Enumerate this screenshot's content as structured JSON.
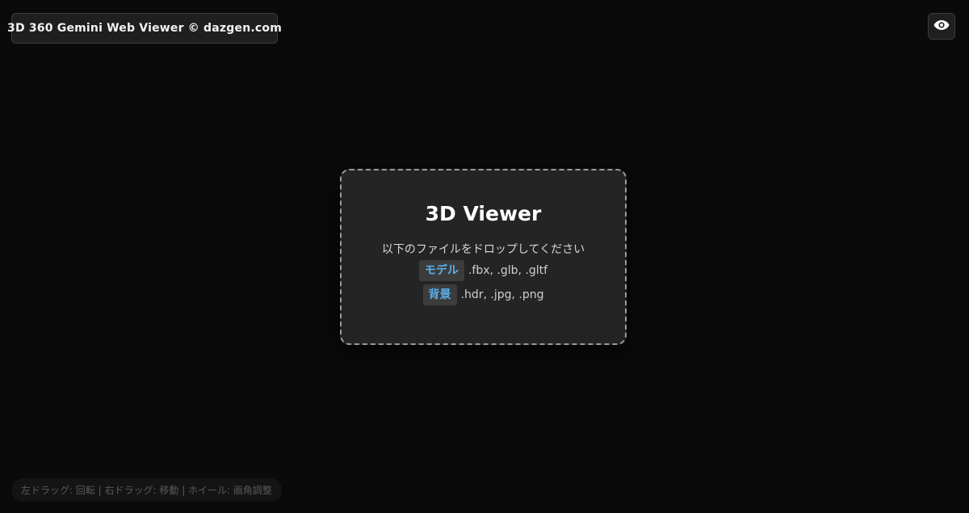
{
  "header": {
    "title": "3D 360 Gemini Web Viewer © dazgen.com",
    "visibility_icon": "eye-icon"
  },
  "drop_panel": {
    "title": "3D Viewer",
    "instruction": "以下のファイルをドロップしてください",
    "formats": [
      {
        "label": "モデル",
        "extensions": ".fbx, .glb, .gltf"
      },
      {
        "label": "背景",
        "extensions": ".hdr, .jpg, .png"
      }
    ]
  },
  "hint": {
    "text": "左ドラッグ: 回転 | 右ドラッグ: 移動 | ホイール: 画角調整"
  },
  "colors": {
    "background": "#0a0a0a",
    "panel": "#242424",
    "accent": "#5aaee8"
  }
}
